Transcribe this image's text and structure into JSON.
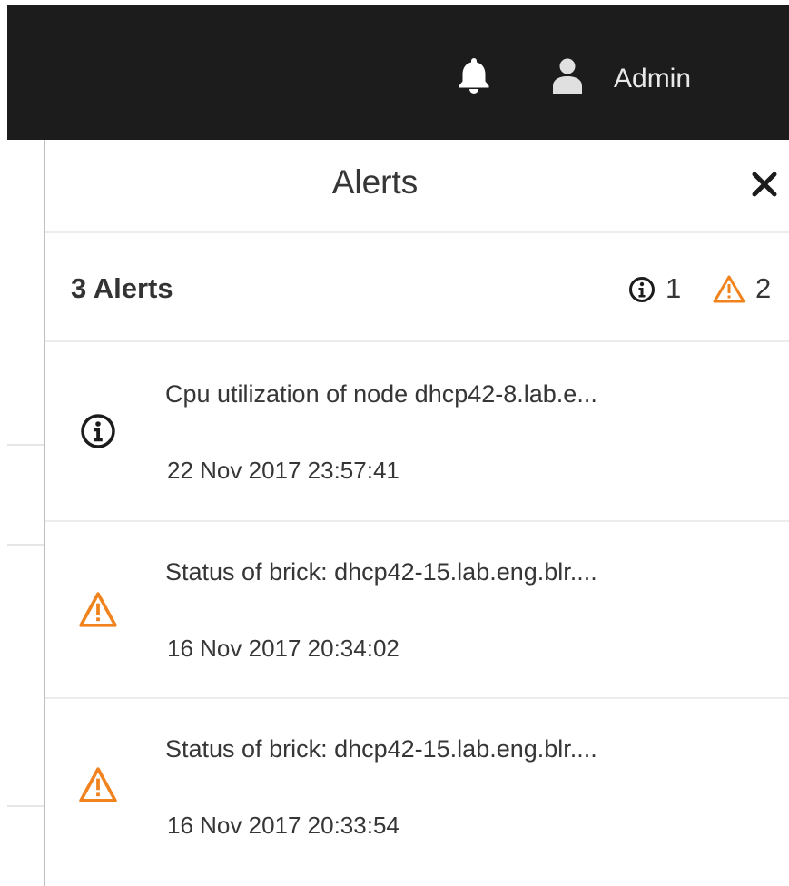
{
  "header": {
    "bell_icon": "bell-icon",
    "user_icon": "user-icon",
    "user_name": "Admin"
  },
  "drawer": {
    "title": "Alerts",
    "close_icon": "close-icon",
    "count_label": "3 Alerts",
    "summary": {
      "info_count": "1",
      "warning_count": "2",
      "warning_color": "#f0831e"
    },
    "alerts": [
      {
        "severity": "info",
        "icon": "info-icon",
        "message": "Cpu utilization of node dhcp42-8.lab.e...",
        "time": "22 Nov 2017 23:57:41"
      },
      {
        "severity": "warning",
        "icon": "warning-icon",
        "message": "Status of brick: dhcp42-15.lab.eng.blr....",
        "time": "16 Nov 2017 20:34:02"
      },
      {
        "severity": "warning",
        "icon": "warning-icon",
        "message": "Status of brick: dhcp42-15.lab.eng.blr....",
        "time": "16 Nov 2017 20:33:54"
      }
    ]
  }
}
